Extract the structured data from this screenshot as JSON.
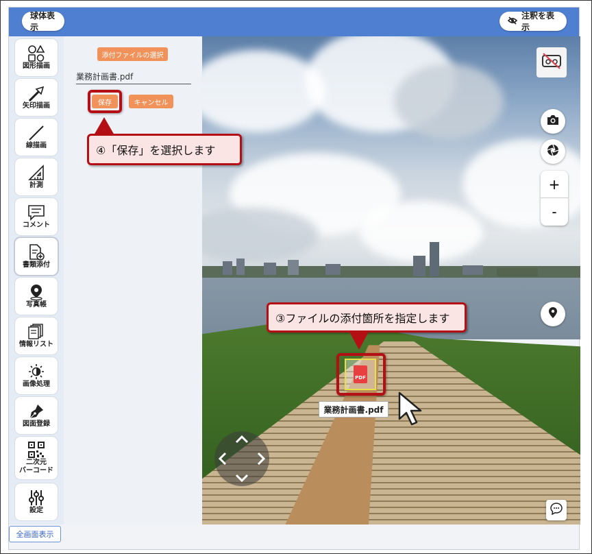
{
  "header": {
    "sphere_button": "球体表示",
    "annotation_button": "注釈を表示",
    "annotation_icon": "eye-slash-icon"
  },
  "sidebar": {
    "items": [
      {
        "label": "図形描画",
        "icon": "shapes-icon"
      },
      {
        "label": "矢印描画",
        "icon": "arrow-icon"
      },
      {
        "label": "線描画",
        "icon": "line-icon"
      },
      {
        "label": "計測",
        "icon": "ruler-icon"
      },
      {
        "label": "コメント",
        "icon": "comment-icon"
      },
      {
        "label": "書類添付",
        "icon": "document-attach-icon"
      },
      {
        "label": "写真帳",
        "icon": "location-pin-icon"
      },
      {
        "label": "情報リスト",
        "icon": "info-list-icon"
      },
      {
        "label": "画像処理",
        "icon": "brightness-icon"
      },
      {
        "label": "図面登録",
        "icon": "pen-nib-icon"
      },
      {
        "label": "二次元\nバーコード",
        "icon": "qr-code-icon"
      },
      {
        "label": "設定",
        "icon": "sliders-icon"
      }
    ]
  },
  "panel": {
    "select_file_button": "添付ファイルの選択",
    "file_name_value": "業務計画書.pdf",
    "save_button": "保存",
    "cancel_button": "キャンセル"
  },
  "viewer": {
    "attachment_label": "業務計画書.pdf",
    "attachment_badge": "PDF",
    "zoom_in": "+",
    "zoom_out": "-",
    "controls": [
      "vr-off-icon",
      "camera-icon",
      "aperture-icon",
      "location-pin-icon",
      "chat-icon"
    ]
  },
  "callouts": {
    "step3": "③ファイルの添付箇所を指定します",
    "step4": "④「保存」を選択します"
  },
  "footer": {
    "fullscreen_button": "全画面表示"
  },
  "colors": {
    "header_bg": "#4f7fd0",
    "accent_orange": "#f0925a",
    "callout_border": "#b40f14",
    "callout_bg": "#fbe4e4"
  }
}
